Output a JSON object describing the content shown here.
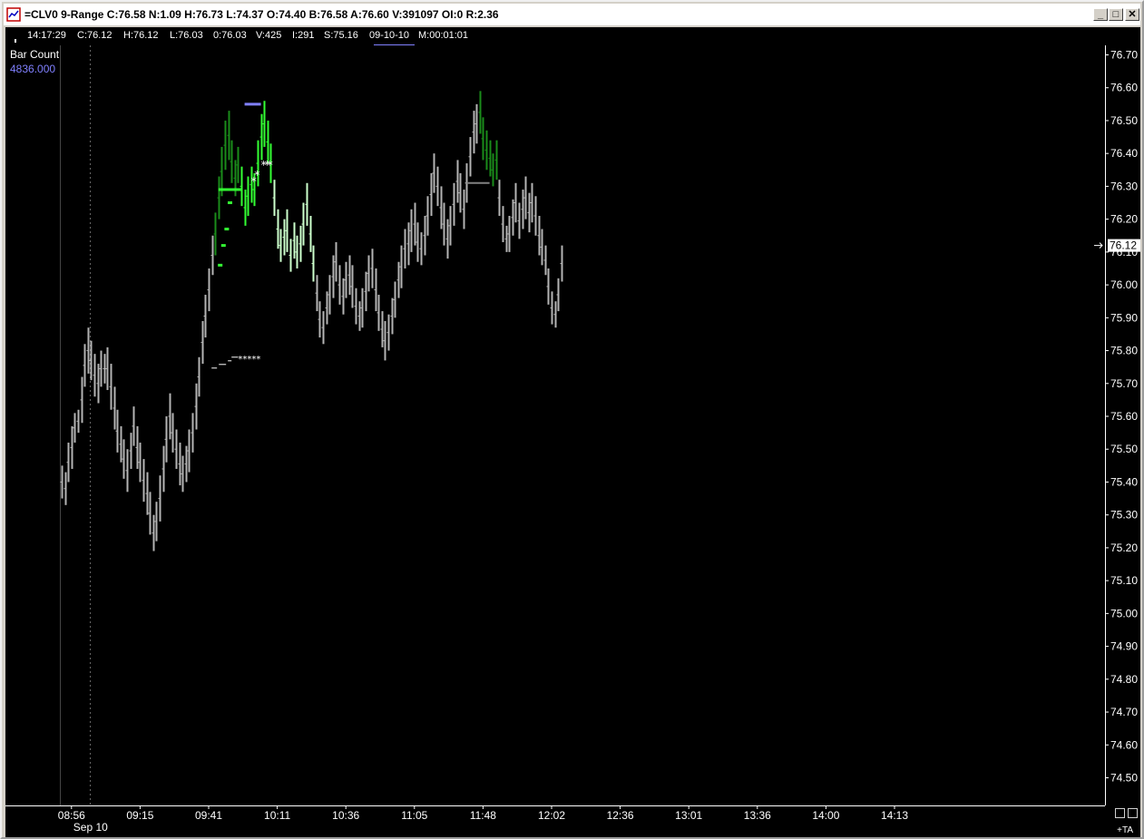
{
  "window": {
    "title": "=CLV0 9-Range C:76.58 N:1.09 H:76.73 L:74.37 O:74.40 B:76.58 A:76.60 V:391097 OI:0 R:2.36",
    "buttons": {
      "minimize": "_",
      "maximize": "□",
      "close": "✕"
    }
  },
  "infobar": {
    "time": "14:17:29",
    "close": "C:76.12",
    "high": "H:76.12",
    "low": "L:76.03",
    "open": "0:76.03",
    "volume": "V:425",
    "interest": "I:291",
    "start": "S:75.16",
    "date": "09-10-10",
    "interval": "M:00:01:01"
  },
  "indicator": {
    "name": "Bar Count",
    "value": "4836.000"
  },
  "corner": {
    "ta_label": "+TA"
  },
  "chart_data": {
    "type": "ohlc",
    "symbol": "CLV0",
    "ylim": [
      74.42,
      76.78
    ],
    "y_ticks": [
      "76.70",
      "76.60",
      "76.50",
      "76.40",
      "76.30",
      "76.20",
      "76.10",
      "76.00",
      "75.90",
      "75.80",
      "75.70",
      "75.60",
      "75.50",
      "75.40",
      "75.30",
      "75.20",
      "75.10",
      "75.00",
      "74.90",
      "74.80",
      "74.70",
      "74.60",
      "74.50"
    ],
    "last_price": "76.12",
    "x_ticks": [
      "08:56",
      "09:15",
      "09:41",
      "10:11",
      "10:36",
      "11:05",
      "11:48",
      "12:02",
      "12:36",
      "13:01",
      "13:36",
      "14:00",
      "14:13"
    ],
    "x_tick_bar_index": [
      3,
      24,
      45,
      66,
      87,
      108,
      129,
      150,
      171,
      192,
      213,
      234,
      255
    ],
    "date_label": "Sep 10",
    "colors": {
      "background": "#000000",
      "bar": "#b4b4b4",
      "up_highlight": "#33ff33",
      "down_highlight": "#1a8c1a",
      "light_green": "#ccffcc",
      "target_line": "#8080ff",
      "axis": "#ffffff"
    },
    "bars": [
      {
        "h": 75.45,
        "l": 75.35
      },
      {
        "h": 75.43,
        "l": 75.33
      },
      {
        "h": 75.52,
        "l": 75.4
      },
      {
        "h": 75.57,
        "l": 75.44
      },
      {
        "h": 75.61,
        "l": 75.52
      },
      {
        "h": 75.62,
        "l": 75.55
      },
      {
        "h": 75.72,
        "l": 75.58
      },
      {
        "h": 75.82,
        "l": 75.69
      },
      {
        "h": 75.87,
        "l": 75.73
      },
      {
        "h": 75.83,
        "l": 75.71
      },
      {
        "h": 75.79,
        "l": 75.66
      },
      {
        "h": 75.76,
        "l": 75.64
      },
      {
        "h": 75.8,
        "l": 75.69
      },
      {
        "h": 75.79,
        "l": 75.7
      },
      {
        "h": 75.81,
        "l": 75.68
      },
      {
        "h": 75.76,
        "l": 75.62
      },
      {
        "h": 75.69,
        "l": 75.56
      },
      {
        "h": 75.62,
        "l": 75.49
      },
      {
        "h": 75.57,
        "l": 75.46
      },
      {
        "h": 75.53,
        "l": 75.41
      },
      {
        "h": 75.5,
        "l": 75.37
      },
      {
        "h": 75.55,
        "l": 75.44
      },
      {
        "h": 75.63,
        "l": 75.51
      },
      {
        "h": 75.57,
        "l": 75.44
      },
      {
        "h": 75.52,
        "l": 75.4
      },
      {
        "h": 75.47,
        "l": 75.34
      },
      {
        "h": 75.43,
        "l": 75.3
      },
      {
        "h": 75.37,
        "l": 75.24
      },
      {
        "h": 75.3,
        "l": 75.19
      },
      {
        "h": 75.34,
        "l": 75.22
      },
      {
        "h": 75.42,
        "l": 75.28
      },
      {
        "h": 75.51,
        "l": 75.37
      },
      {
        "h": 75.6,
        "l": 75.46
      },
      {
        "h": 75.67,
        "l": 75.53
      },
      {
        "h": 75.61,
        "l": 75.49
      },
      {
        "h": 75.56,
        "l": 75.44
      },
      {
        "h": 75.52,
        "l": 75.39
      },
      {
        "h": 75.48,
        "l": 75.37
      },
      {
        "h": 75.51,
        "l": 75.4
      },
      {
        "h": 75.56,
        "l": 75.43
      },
      {
        "h": 75.61,
        "l": 75.49
      },
      {
        "h": 75.7,
        "l": 75.56
      },
      {
        "h": 75.78,
        "l": 75.66
      },
      {
        "h": 75.89,
        "l": 75.76
      },
      {
        "h": 75.97,
        "l": 75.84
      },
      {
        "h": 76.05,
        "l": 75.92
      },
      {
        "h": 76.15,
        "l": 76.03
      },
      {
        "h": 76.22,
        "l": 76.09,
        "c": "dg"
      },
      {
        "h": 76.33,
        "l": 76.2,
        "c": "dg"
      },
      {
        "h": 76.42,
        "l": 76.27,
        "c": "dg"
      },
      {
        "h": 76.5,
        "l": 76.35,
        "c": "dg"
      },
      {
        "h": 76.53,
        "l": 76.38,
        "c": "dg"
      },
      {
        "h": 76.44,
        "l": 76.31,
        "c": "dg"
      },
      {
        "h": 76.38,
        "l": 76.27,
        "c": "dg"
      },
      {
        "h": 76.42,
        "l": 76.31,
        "c": "dg"
      },
      {
        "h": 76.36,
        "l": 76.24,
        "c": "ug"
      },
      {
        "h": 76.29,
        "l": 76.18,
        "c": "ug"
      },
      {
        "h": 76.33,
        "l": 76.21,
        "c": "ug"
      },
      {
        "h": 76.36,
        "l": 76.25,
        "c": "ug"
      },
      {
        "h": 76.34,
        "l": 76.24,
        "c": "ug"
      },
      {
        "h": 76.44,
        "l": 76.3,
        "c": "ug"
      },
      {
        "h": 76.52,
        "l": 76.38,
        "c": "ug"
      },
      {
        "h": 76.56,
        "l": 76.42,
        "c": "ug"
      },
      {
        "h": 76.5,
        "l": 76.37,
        "c": "ug"
      },
      {
        "h": 76.43,
        "l": 76.31,
        "c": "ug"
      },
      {
        "h": 76.32,
        "l": 76.21,
        "c": "lg"
      },
      {
        "h": 76.23,
        "l": 76.11,
        "c": "lg"
      },
      {
        "h": 76.17,
        "l": 76.07,
        "c": "lg"
      },
      {
        "h": 76.2,
        "l": 76.09,
        "c": "lg"
      },
      {
        "h": 76.23,
        "l": 76.1,
        "c": "lg"
      },
      {
        "h": 76.14,
        "l": 76.04,
        "c": "lg"
      },
      {
        "h": 76.19,
        "l": 76.08,
        "c": "lg"
      },
      {
        "h": 76.15,
        "l": 76.05,
        "c": "lg"
      },
      {
        "h": 76.18,
        "l": 76.07,
        "c": "lg"
      },
      {
        "h": 76.25,
        "l": 76.12,
        "c": "lg"
      },
      {
        "h": 76.31,
        "l": 76.18,
        "c": "lg"
      },
      {
        "h": 76.21,
        "l": 76.1,
        "c": "lg"
      },
      {
        "h": 76.12,
        "l": 76.01,
        "c": "lg"
      },
      {
        "h": 76.03,
        "l": 75.92
      },
      {
        "h": 75.95,
        "l": 75.84
      },
      {
        "h": 75.92,
        "l": 75.82
      },
      {
        "h": 75.98,
        "l": 75.88
      },
      {
        "h": 76.03,
        "l": 75.91
      },
      {
        "h": 76.09,
        "l": 75.96
      },
      {
        "h": 76.13,
        "l": 76.01
      },
      {
        "h": 76.06,
        "l": 75.94
      },
      {
        "h": 76.02,
        "l": 75.91
      },
      {
        "h": 76.07,
        "l": 75.96
      },
      {
        "h": 76.09,
        "l": 75.97
      },
      {
        "h": 76.06,
        "l": 75.93
      },
      {
        "h": 75.99,
        "l": 75.88
      },
      {
        "h": 75.95,
        "l": 75.86
      },
      {
        "h": 75.99,
        "l": 75.87
      },
      {
        "h": 76.04,
        "l": 75.92
      },
      {
        "h": 76.09,
        "l": 75.98
      },
      {
        "h": 76.11,
        "l": 75.99
      },
      {
        "h": 76.05,
        "l": 75.92
      },
      {
        "h": 75.97,
        "l": 75.86
      },
      {
        "h": 75.92,
        "l": 75.81
      },
      {
        "h": 75.89,
        "l": 75.77
      },
      {
        "h": 75.91,
        "l": 75.8
      },
      {
        "h": 75.96,
        "l": 75.85
      },
      {
        "h": 76.01,
        "l": 75.9
      },
      {
        "h": 76.07,
        "l": 75.96
      },
      {
        "h": 76.12,
        "l": 75.99
      },
      {
        "h": 76.17,
        "l": 76.05
      },
      {
        "h": 76.19,
        "l": 76.06
      },
      {
        "h": 76.23,
        "l": 76.1
      },
      {
        "h": 76.25,
        "l": 76.12
      },
      {
        "h": 76.19,
        "l": 76.07
      },
      {
        "h": 76.16,
        "l": 76.06
      },
      {
        "h": 76.21,
        "l": 76.09
      },
      {
        "h": 76.27,
        "l": 76.15
      },
      {
        "h": 76.34,
        "l": 76.21
      },
      {
        "h": 76.4,
        "l": 76.28
      },
      {
        "h": 76.36,
        "l": 76.24
      },
      {
        "h": 76.3,
        "l": 76.17
      },
      {
        "h": 76.25,
        "l": 76.12
      },
      {
        "h": 76.2,
        "l": 76.08
      },
      {
        "h": 76.24,
        "l": 76.12
      },
      {
        "h": 76.31,
        "l": 76.18
      },
      {
        "h": 76.38,
        "l": 76.25
      },
      {
        "h": 76.34,
        "l": 76.22
      },
      {
        "h": 76.29,
        "l": 76.17
      },
      {
        "h": 76.37,
        "l": 76.25
      },
      {
        "h": 76.45,
        "l": 76.33
      },
      {
        "h": 76.53,
        "l": 76.4
      },
      {
        "h": 76.55,
        "l": 76.43
      },
      {
        "h": 76.59,
        "l": 76.46,
        "c": "dg"
      },
      {
        "h": 76.51,
        "l": 76.38,
        "c": "dg"
      },
      {
        "h": 76.47,
        "l": 76.35,
        "c": "dg"
      },
      {
        "h": 76.44,
        "l": 76.33,
        "c": "dg"
      },
      {
        "h": 76.4,
        "l": 76.3,
        "c": "dg"
      },
      {
        "h": 76.44,
        "l": 76.32,
        "c": "dg"
      },
      {
        "h": 76.32,
        "l": 76.21
      },
      {
        "h": 76.24,
        "l": 76.13
      },
      {
        "h": 76.18,
        "l": 76.1
      },
      {
        "h": 76.21,
        "l": 76.1
      },
      {
        "h": 76.26,
        "l": 76.15
      },
      {
        "h": 76.31,
        "l": 76.19
      },
      {
        "h": 76.25,
        "l": 76.14
      },
      {
        "h": 76.29,
        "l": 76.17
      },
      {
        "h": 76.33,
        "l": 76.2
      },
      {
        "h": 76.28,
        "l": 76.16
      },
      {
        "h": 76.31,
        "l": 76.19
      },
      {
        "h": 76.27,
        "l": 76.15
      },
      {
        "h": 76.21,
        "l": 76.09
      },
      {
        "h": 76.17,
        "l": 76.06
      },
      {
        "h": 76.12,
        "l": 76.03
      },
      {
        "h": 76.05,
        "l": 75.94
      },
      {
        "h": 75.98,
        "l": 75.88
      },
      {
        "h": 75.95,
        "l": 75.87
      },
      {
        "h": 76.02,
        "l": 75.92
      },
      {
        "h": 76.12,
        "l": 76.01
      }
    ],
    "annotations": {
      "target_line": {
        "bar_from": 56,
        "bar_to": 61,
        "y": 76.55
      },
      "resistance_line": {
        "bar_from": 124,
        "bar_to": 131,
        "y": 76.31
      },
      "support_line": {
        "bar_from": 48,
        "bar_to": 55,
        "y": 76.29
      },
      "dashes": [
        {
          "bar": 47,
          "y": 76.06
        },
        {
          "bar": 48,
          "y": 76.12
        },
        {
          "bar": 49,
          "y": 76.17
        },
        {
          "bar": 50,
          "y": 76.25
        }
      ],
      "stars": [
        {
          "bar": 58,
          "y": 76.32
        },
        {
          "bar": 59,
          "y": 76.34
        },
        {
          "bar": 61,
          "y": 76.37
        },
        {
          "bar": 62,
          "y": 76.37
        },
        {
          "bar": 63,
          "y": 76.37
        }
      ],
      "ghost_row": {
        "bar_from": 47,
        "bar_to": 54,
        "y": 75.78
      },
      "ghost_stars_from": 54
    }
  }
}
